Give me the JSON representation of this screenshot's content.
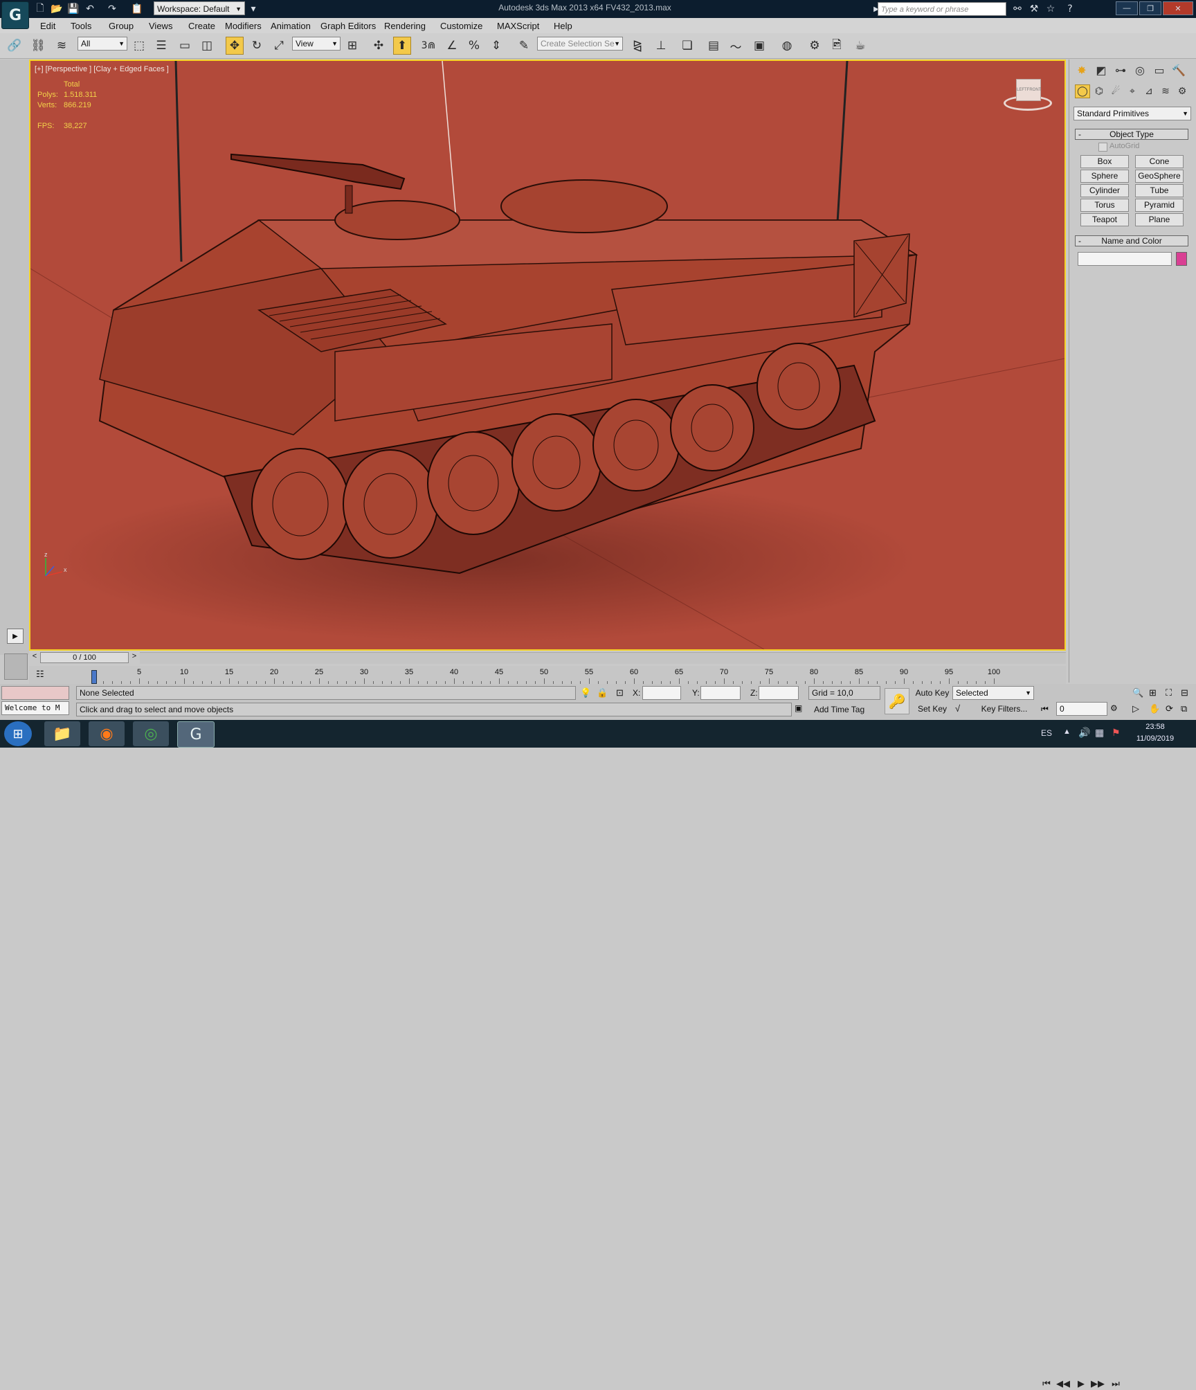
{
  "titlebar": {
    "app_logo": "G",
    "workspace_label": "Workspace: Default",
    "title": "Autodesk 3ds Max  2013 x64       FV432_2013.max",
    "search_placeholder": "Type a keyword or phrase",
    "window_minimize": "—",
    "window_restore": "❐",
    "window_close": "✕"
  },
  "menu": [
    "Edit",
    "Tools",
    "Group",
    "Views",
    "Create",
    "Modifiers",
    "Animation",
    "Graph Editors",
    "Rendering",
    "Customize",
    "MAXScript",
    "Help"
  ],
  "toolbar": {
    "selection_filter": "All",
    "reference_coord": "View",
    "named_selection_placeholder": "Create Selection Se",
    "snap_label": "3"
  },
  "viewport": {
    "label": "[+] [Perspective ] [Clay + Edged Faces ]",
    "stats_header": "Total",
    "polys_label": "Polys:",
    "polys_value": "1.518.311",
    "verts_label": "Verts:",
    "verts_value": "866.219",
    "fps_label": "FPS:",
    "fps_value": "38,227",
    "viewcube_left": "LEFT",
    "viewcube_front": "FRONT",
    "axis_z": "z",
    "axis_x": "x"
  },
  "command_panel": {
    "category_dropdown": "Standard Primitives",
    "object_type_title": "Object Type",
    "autogrid_label": "AutoGrid",
    "buttons": [
      "Box",
      "Cone",
      "Sphere",
      "GeoSphere",
      "Cylinder",
      "Tube",
      "Torus",
      "Pyramid",
      "Teapot",
      "Plane"
    ],
    "name_color_title": "Name and Color",
    "name_value": "",
    "object_color": "#d93f93",
    "rollout_minus": "-"
  },
  "timeline": {
    "frame_counter": "0 / 100",
    "prev_arrow": "<",
    "next_arrow": ">",
    "ticks": [
      "0",
      "5",
      "10",
      "15",
      "20",
      "25",
      "30",
      "35",
      "40",
      "45",
      "50",
      "55",
      "60",
      "65",
      "70",
      "75",
      "80",
      "85",
      "90",
      "95",
      "100"
    ]
  },
  "status": {
    "maxscript_listener": "Welcome to M",
    "selection_status": "None Selected",
    "prompt": "Click and drag to select and move objects",
    "x_label": "X:",
    "y_label": "Y:",
    "z_label": "Z:",
    "x_value": "",
    "y_value": "",
    "z_value": "",
    "grid": "Grid = 10,0",
    "add_time_tag": "Add Time Tag",
    "auto_key": "Auto Key",
    "set_key": "Set Key",
    "key_mode_dropdown": "Selected",
    "key_filters": "Key Filters...",
    "current_frame": "0"
  },
  "taskbar": {
    "language": "ES",
    "time": "23:58",
    "date": "11/09/2019"
  },
  "colors": {
    "viewport_bg": "#b24a3a",
    "active_border": "#f5d327",
    "stats_text": "#f2d24a",
    "active_tool": "#f3c94a"
  }
}
